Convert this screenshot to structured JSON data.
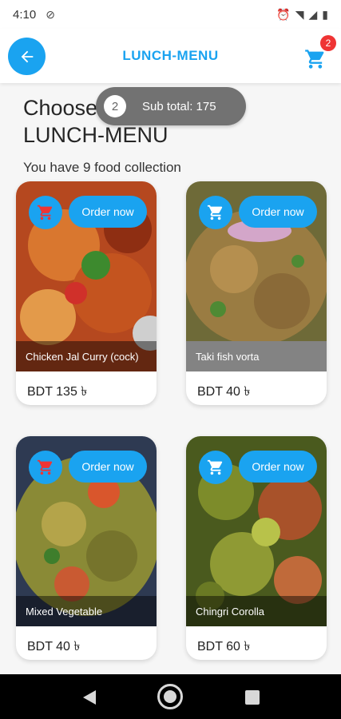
{
  "status_bar": {
    "time": "4:10"
  },
  "app_bar": {
    "title": "LUNCH-MENU",
    "cart_count": "2"
  },
  "heading": "Choose your item from LUNCH-MENU",
  "subheading": "You have 9 food collection",
  "toast": {
    "count": "2",
    "text": "Sub total: 175"
  },
  "order_label": "Order now",
  "foods": [
    {
      "name": "Chicken Jal Curry (cock)",
      "price": "BDT 135 ৳"
    },
    {
      "name": "Taki fish vorta",
      "price": "BDT 40 ৳"
    },
    {
      "name": "Mixed Vegetable",
      "price": "BDT 40 ৳"
    },
    {
      "name": "Chingri Corolla",
      "price": "BDT 60 ৳"
    }
  ],
  "colors": {
    "accent": "#1aa3f0",
    "badge": "#ef3434",
    "toast": "#727272"
  }
}
